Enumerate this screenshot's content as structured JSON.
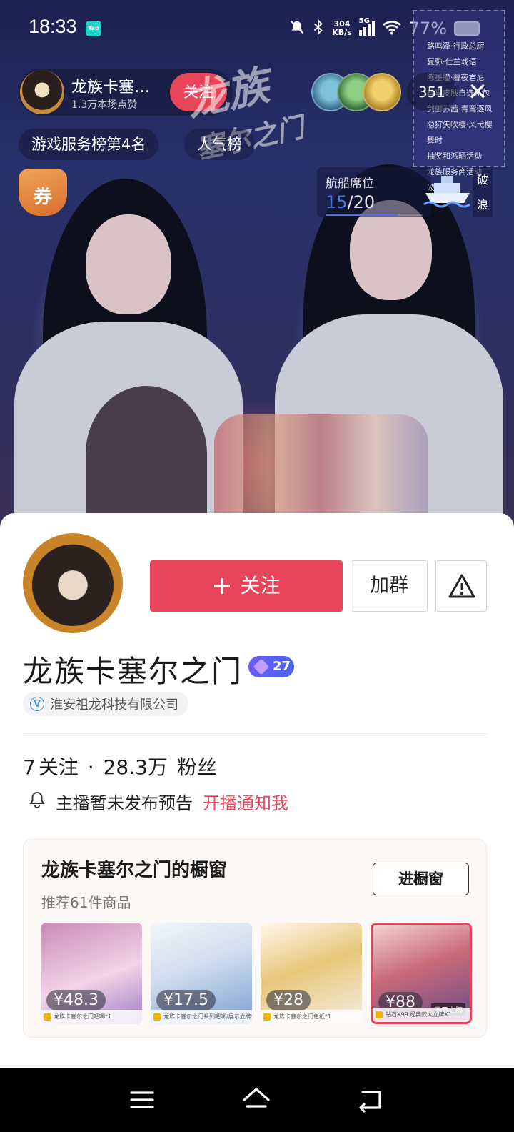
{
  "status_bar": {
    "time": "18:33",
    "app_badge": "Tap",
    "net_speed_value": "304",
    "net_speed_unit": "KB/s",
    "network": "5G",
    "battery": "77%"
  },
  "live": {
    "host_name": "龙族卡塞…",
    "likes": "1.3万本场点赞",
    "follow_label": "关注",
    "logo_main": "龙族",
    "logo_sub": "塞尔之门",
    "viewer_count": "351",
    "close_glyph": "✕",
    "rank_tag": "游戏服务榜第4名",
    "pop_tag": "人气榜",
    "coupon_label": "券",
    "voyage_title": "航船席位",
    "voyage_current": "15",
    "voyage_total": "/20",
    "voyage_progress": 0.75,
    "wave_top": "破",
    "wave_bottom": "浪",
    "notice_lines": [
      "路鸣泽·行政总厨",
      "夏弥·仕兰戏语",
      "陈墨瞳·暮夜君尼",
      "尊享皮肤自选礼包",
      "剑御苏茜·青鸾逐风",
      "隐狩矢吹樱·风弋樱舞时",
      "抽奖和派晒活动",
      "龙族服务商活动",
      "破浪联动"
    ]
  },
  "profile": {
    "follow_label": "关注",
    "group_label": "加群",
    "name": "龙族卡塞尔之门",
    "level": "27",
    "verify_mark": "V",
    "company": "淮安祖龙科技有限公司",
    "following": "7",
    "following_label": "关注",
    "separator": "·",
    "followers": "28.3万",
    "followers_label": "粉丝",
    "preview_text": "主播暂未发布预告",
    "notify_label": "开播通知我"
  },
  "shop": {
    "title": "龙族卡塞尔之门的橱窗",
    "subtitle": "推荐61件商品",
    "button_label": "进橱窗",
    "products": [
      {
        "price": "¥48.3",
        "strip": "龙族卡塞尔之门吧唧*1"
      },
      {
        "price": "¥17.5",
        "strip": "龙族卡塞尔之门系列吧唧/展示立牌*1"
      },
      {
        "price": "¥28",
        "strip": "龙族卡塞尔之门色纸*1"
      },
      {
        "price": "¥88",
        "strip": "钻石X99 经典款大立牌X1",
        "badge": "展示立牌"
      }
    ]
  },
  "colors": {
    "accent": "#e8455a",
    "level_badge": "#5b5ff2",
    "voyage_progress": "#4a74d8"
  },
  "icons": {
    "report": "warning-triangle-icon",
    "bell": "bell-icon",
    "verify": "verified-v-icon",
    "nav_menu": "menu-icon",
    "nav_home": "home-icon",
    "nav_back": "back-icon"
  }
}
